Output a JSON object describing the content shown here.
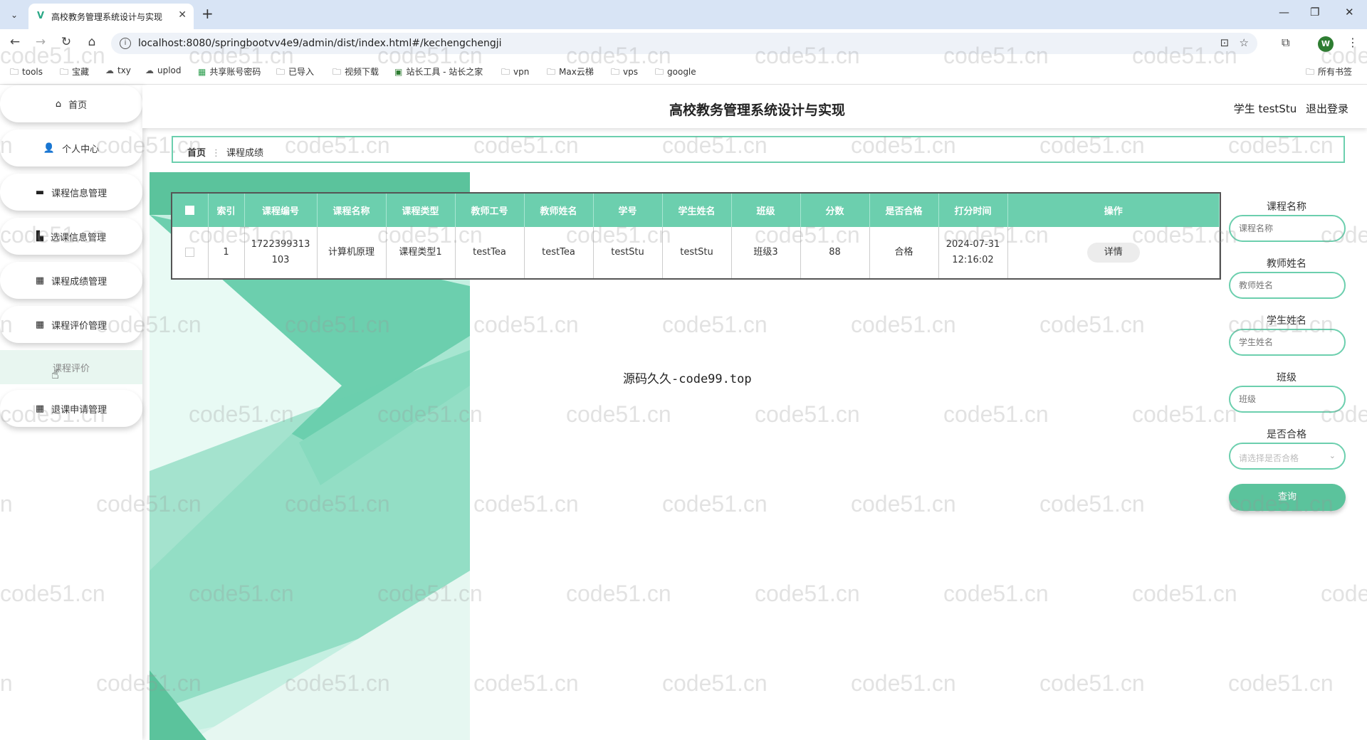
{
  "browser": {
    "tab_title": "高校教务管理系统设计与实现",
    "url": "localhost:8080/springbootvv4e9/admin/dist/index.html#/kechengchengji",
    "profile_initial": "W",
    "bookmarks": [
      "tools",
      "宝藏",
      "txy",
      "uplod",
      "共享账号密码",
      "已导入",
      "视频下载",
      "站长工具 - 站长之家",
      "vpn",
      "Max云梯",
      "vps",
      "google"
    ],
    "all_bookmarks": "所有书签"
  },
  "header": {
    "title": "高校教务管理系统设计与实现",
    "user": "学生 testStu",
    "logout": "退出登录"
  },
  "sidebar": {
    "items": [
      {
        "label": "首页",
        "icon": "home-icon"
      },
      {
        "label": "个人中心",
        "icon": "user-icon"
      },
      {
        "label": "课程信息管理",
        "icon": "briefcase-icon"
      },
      {
        "label": "选课信息管理",
        "icon": "chart-icon"
      },
      {
        "label": "课程成绩管理",
        "icon": "grid-icon"
      },
      {
        "label": "课程评价管理",
        "icon": "grid-icon"
      },
      {
        "label": "退课申请管理",
        "icon": "grid-icon"
      }
    ],
    "submenu": "课程评价"
  },
  "breadcrumb": {
    "home": "首页",
    "current": "课程成绩"
  },
  "table": {
    "headers": [
      "索引",
      "课程编号",
      "课程名称",
      "课程类型",
      "教师工号",
      "教师姓名",
      "学号",
      "学生姓名",
      "班级",
      "分数",
      "是否合格",
      "打分时间",
      "操作"
    ],
    "rows": [
      {
        "index": "1",
        "course_no": "1722399313103",
        "course_name": "计算机原理",
        "course_type": "课程类型1",
        "teacher_no": "testTea",
        "teacher_name": "testTea",
        "student_no": "testStu",
        "student_name": "testStu",
        "class": "班级3",
        "score": "88",
        "passed": "合格",
        "time": "2024-07-31 12:16:02",
        "action": "详情"
      }
    ]
  },
  "search": {
    "course_name_label": "课程名称",
    "course_name_placeholder": "课程名称",
    "teacher_name_label": "教师姓名",
    "teacher_name_placeholder": "教师姓名",
    "student_name_label": "学生姓名",
    "student_name_placeholder": "学生姓名",
    "class_label": "班级",
    "class_placeholder": "班级",
    "passed_label": "是否合格",
    "passed_placeholder": "请选择是否合格",
    "query_button": "查询"
  },
  "center_text": "源码久久-code99.top",
  "watermark": "code51.cn",
  "colors": {
    "accent": "#6ccfae",
    "button": "#5bc39c"
  }
}
